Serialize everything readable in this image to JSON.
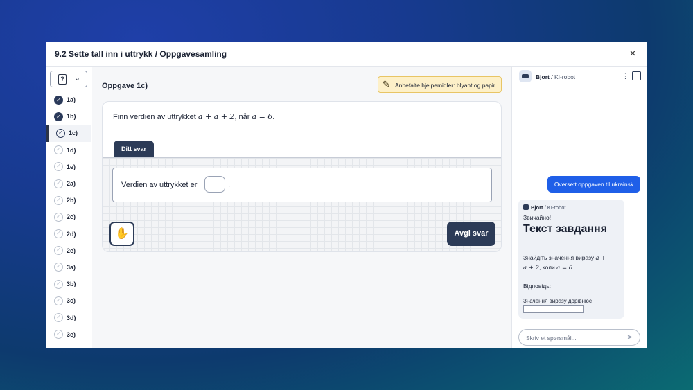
{
  "window": {
    "title": "9.2 Sette tall inn i uttrykk / Oppgavesamling",
    "close_icon": "×"
  },
  "sidebar": {
    "dropdown_icon": "?",
    "dropdown_chevron": "⌄",
    "items": [
      {
        "label": "1a)",
        "state": "done"
      },
      {
        "label": "1b)",
        "state": "done"
      },
      {
        "label": "1c)",
        "state": "current"
      },
      {
        "label": "1d)",
        "state": "todo"
      },
      {
        "label": "1e)",
        "state": "todo"
      },
      {
        "label": "2a)",
        "state": "todo"
      },
      {
        "label": "2b)",
        "state": "todo"
      },
      {
        "label": "2c)",
        "state": "todo"
      },
      {
        "label": "2d)",
        "state": "todo"
      },
      {
        "label": "2e)",
        "state": "todo"
      },
      {
        "label": "3a)",
        "state": "todo"
      },
      {
        "label": "3b)",
        "state": "todo"
      },
      {
        "label": "3c)",
        "state": "todo"
      },
      {
        "label": "3d)",
        "state": "todo"
      },
      {
        "label": "3e)",
        "state": "todo"
      }
    ]
  },
  "main": {
    "task_title": "Oppgave 1c)",
    "tools_badge": "Anbefalte hjelpemidler: blyant og papir",
    "question_pre": "Finn verdien av uttrykket ",
    "question_expr": "a + a + 2",
    "question_mid": ", når ",
    "question_cond": "a = 6",
    "question_end": ".",
    "answer_tab": "Ditt svar",
    "answer_pre": "Verdien av uttrykket er",
    "answer_post": ".",
    "answer_value": "",
    "hand_icon": "✋",
    "submit_label": "Avgi svar"
  },
  "chat": {
    "bot_name": "Bjort",
    "bot_role": "KI-robot",
    "menu_icon": "⋮",
    "user_message": "Oversett oppgaven til ukrainsk",
    "reply": {
      "greeting": "Звичайно!",
      "heading": "Текст завдання",
      "body_pre": "Знайдіть значення виразу ",
      "body_expr": "a + 2",
      "body_mid": ", коли ",
      "body_cond": "a = 6",
      "body_end": ".",
      "body_lead": "a +",
      "answer_label": "Відповідь:",
      "answer_text": "Значення виразу дорівнює",
      "answer_dot": "."
    },
    "input_placeholder": "Skriv et spørsmål...",
    "send_icon": "➤"
  },
  "colors": {
    "accent": "#2c3b57",
    "user_bubble": "#1f5fe8",
    "badge_bg": "#fdf0c8"
  }
}
